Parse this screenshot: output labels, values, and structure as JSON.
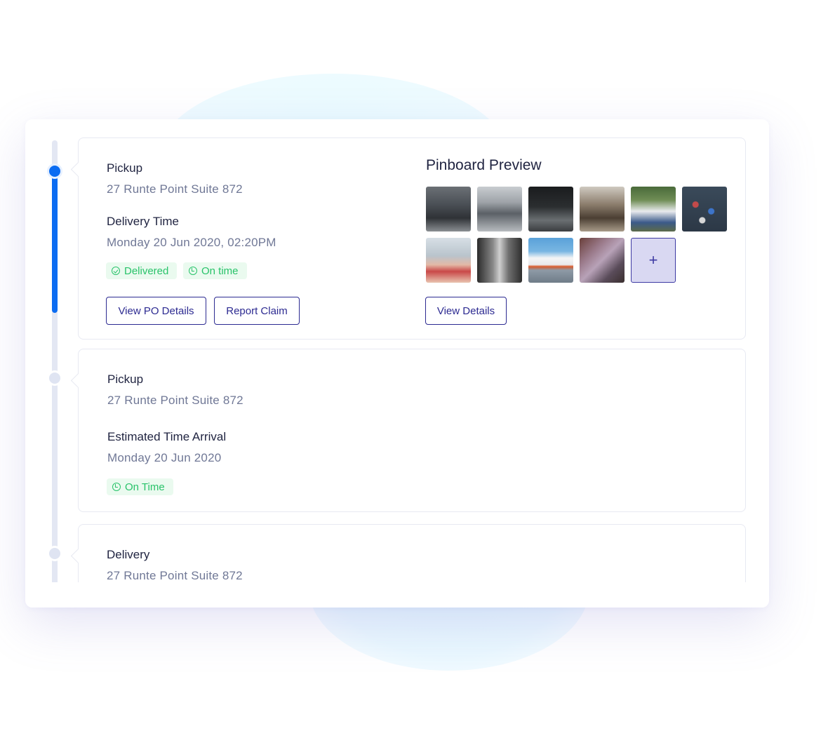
{
  "timeline": {
    "cards": [
      {
        "pickup_label": "Pickup",
        "pickup_address": "27 Runte Point Suite 872",
        "time_label": "Delivery Time",
        "time_value": "Monday 20 Jun 2020, 02:20PM",
        "tags": [
          "Delivered",
          "On time"
        ],
        "buttons": [
          "View PO Details",
          "Report Claim"
        ],
        "pinboard": {
          "title": "Pinboard Preview",
          "add_label": "+",
          "view_details_label": "View Details"
        }
      },
      {
        "pickup_label": "Pickup",
        "pickup_address": "27 Runte Point Suite 872",
        "time_label": "Estimated Time Arrival",
        "time_value": "Monday 20 Jun 2020",
        "tags": [
          "On Time"
        ]
      },
      {
        "pickup_label": "Delivery",
        "pickup_address": "27 Runte Point Suite 872"
      }
    ]
  },
  "colors": {
    "accent": "#0b6cf2",
    "button_border": "#2c2a91",
    "tag_green": "#29c36a",
    "tag_bg": "#eafaef",
    "muted_text": "#707896"
  },
  "icons": {
    "delivered": "check-circle-icon",
    "on_time": "clock-icon",
    "add": "plus-icon"
  }
}
